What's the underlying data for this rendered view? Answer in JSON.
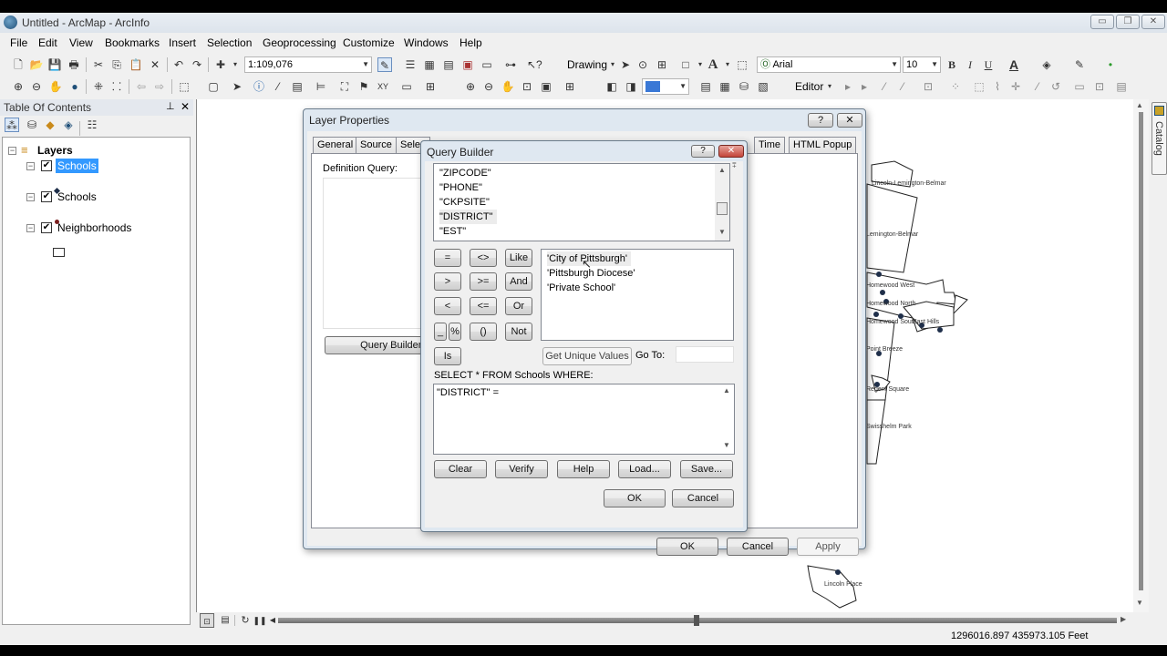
{
  "window": {
    "title": "Untitled - ArcMap - ArcInfo",
    "controls": {
      "minimize": "▭",
      "restore": "❐",
      "close": "✕"
    }
  },
  "menu": [
    "File",
    "Edit",
    "View",
    "Bookmarks",
    "Insert",
    "Selection",
    "Geoprocessing",
    "Customize",
    "Windows",
    "Help"
  ],
  "toolbar": {
    "scale": "1:109,076",
    "drawing_label": "Drawing",
    "font_name": "Arial",
    "font_size": "10",
    "bold": "B",
    "italic": "I",
    "underline": "U",
    "editor_label": "Editor",
    "icons": {
      "new": "new-document-icon",
      "open": "open-folder-icon",
      "save": "save-icon",
      "print": "print-icon",
      "cut": "cut-icon",
      "copy": "copy-icon",
      "paste": "paste-icon",
      "delete": "delete-icon",
      "undo": "undo-icon",
      "redo": "redo-icon",
      "add_data": "add-data-icon",
      "zoom_in": "zoom-in-icon",
      "zoom_out": "zoom-out-icon",
      "pan": "pan-icon",
      "full_extent": "globe-icon",
      "back": "back-arrow-icon",
      "forward": "forward-arrow-icon",
      "select": "select-arrow-icon",
      "identify": "identify-icon",
      "find": "binoculars-icon"
    }
  },
  "toc": {
    "title": "Table Of Contents",
    "root": "Layers",
    "layers": [
      {
        "name": "Schools",
        "checked": true,
        "selected": true,
        "symbol_color": "#1f2f4a"
      },
      {
        "name": "Schools",
        "checked": true,
        "selected": false,
        "symbol_color": "#7a1d1d"
      },
      {
        "name": "Neighborhoods",
        "checked": true,
        "selected": false,
        "symbol_color": "#ffffff"
      }
    ]
  },
  "layer_properties": {
    "title": "Layer Properties",
    "tabs": [
      "General",
      "Source",
      "Selec",
      "Time",
      "HTML Popup"
    ],
    "definition_query_label": "Definition Query:",
    "definition_query_value": "",
    "query_builder_button": "Query Builder...",
    "ok": "OK",
    "cancel": "Cancel",
    "apply": "Apply"
  },
  "query_builder": {
    "title": "Query Builder",
    "fields": [
      "\"ZIPCODE\"",
      "\"PHONE\"",
      "\"CKPSITE\"",
      "\"DISTRICT\"",
      "\"EST\""
    ],
    "selected_field": "\"DISTRICT\"",
    "operators": [
      "=",
      "<>",
      "Like",
      ">",
      ">=",
      "And",
      "<",
      "<=",
      "Or",
      "_",
      "%",
      "()",
      "Not",
      "Is"
    ],
    "unique_values": [
      "'City of Pittsburgh'",
      "'Pittsburgh Diocese'",
      "'Private School'"
    ],
    "get_unique_values": "Get Unique Values",
    "goto_label": "Go To:",
    "goto_value": "",
    "sql_prefix": "SELECT * FROM Schools WHERE:",
    "sql_expression": "\"DISTRICT\" =",
    "buttons": {
      "clear": "Clear",
      "verify": "Verify",
      "help": "Help",
      "load": "Load...",
      "save": "Save...",
      "ok": "OK",
      "cancel": "Cancel"
    }
  },
  "map": {
    "labels": [
      "Lemington-Belmar",
      "Lincoln-Lemington-Belmar",
      "Homewood West",
      "Homewood North",
      "Homewood South",
      "East Hills",
      "Point Breeze",
      "Regent Square",
      "Swisshelm Park",
      "Lincoln Place"
    ]
  },
  "statusbar": {
    "coordinates": "1296016.897  435973.105 Feet"
  },
  "catalog_tab": "Catalog"
}
